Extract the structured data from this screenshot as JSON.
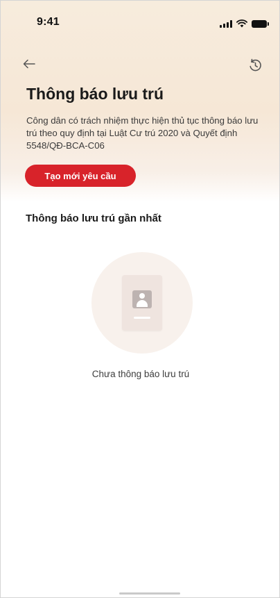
{
  "status_bar": {
    "time": "9:41",
    "icons": [
      "signal-icon",
      "wifi-icon",
      "battery-icon"
    ]
  },
  "nav": {
    "back_icon": "arrow-left-icon",
    "history_icon": "history-icon"
  },
  "header": {
    "title": "Thông báo lưu trú",
    "description": "Công dân có trách nhiệm thực hiện thủ tục thông báo lưu trú theo quy định tại Luật Cư trú 2020 và Quyết định 5548/QĐ-BCA-C06",
    "create_button_label": "Tạo mới yêu cầu"
  },
  "main": {
    "section_title": "Thông báo lưu trú gần nhất",
    "empty_state": {
      "icon": "document-avatar-icon",
      "message": "Chưa thông báo lưu trú"
    }
  },
  "colors": {
    "accent": "#d8232a",
    "hero_bg": "#f7ecdd",
    "text_primary": "#1a1a1a"
  }
}
